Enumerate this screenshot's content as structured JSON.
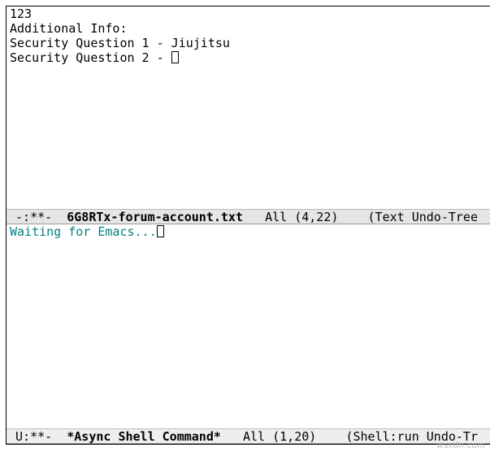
{
  "buffer1": {
    "lines": [
      "123",
      "Additional Info:",
      "Security Question 1 - Jiujitsu",
      "Security Question 2 - "
    ]
  },
  "modeline1": {
    "left": " -:**-  ",
    "buffer_name": "6G8RTx-forum-account.txt",
    "mid": "   All (4,22)    ",
    "right": "(Text Undo-Tree"
  },
  "buffer2": {
    "minibuffer_text": "Waiting for Emacs..."
  },
  "modeline2": {
    "left": " U:**-  ",
    "buffer_name": "*Async Shell Command*",
    "mid": "   All (1,20)    ",
    "right": "(Shell:run Undo-Tr"
  },
  "watermark": "wsxdn.com"
}
